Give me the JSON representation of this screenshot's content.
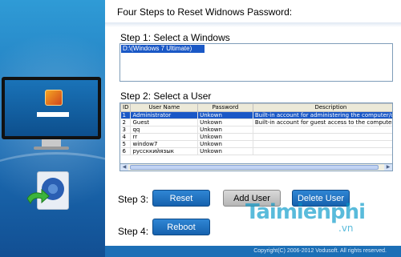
{
  "title": "Four Steps to Reset Widnows Password:",
  "step1": {
    "label": "Step 1: Select a Windows",
    "windows": [
      "D:\\(Windows 7 Ultimate)"
    ]
  },
  "step2": {
    "label": "Step 2: Select a User",
    "columns": [
      "ID",
      "User Name",
      "Password",
      "Description"
    ],
    "rows": [
      {
        "id": "1",
        "name": "Administrator",
        "password": "Unkown",
        "description": "Built-in account for administering the computer/doma"
      },
      {
        "id": "2",
        "name": "Guest",
        "password": "Unkown",
        "description": "Built-in account for guest access to the computer/do"
      },
      {
        "id": "3",
        "name": "qq",
        "password": "Unkown",
        "description": ""
      },
      {
        "id": "4",
        "name": "rr",
        "password": "Unkown",
        "description": ""
      },
      {
        "id": "5",
        "name": "window7",
        "password": "Unkown",
        "description": ""
      },
      {
        "id": "6",
        "name": "руссккийязык",
        "password": "Unkown",
        "description": ""
      }
    ],
    "selected_row": 0
  },
  "step3": {
    "label": "Step 3:",
    "reset_label": "Reset",
    "add_user_label": "Add User",
    "delete_user_label": "Delete User"
  },
  "step4": {
    "label": "Step 4:",
    "reboot_label": "Reboot"
  },
  "footer": "Copyright(C) 2006-2012 Vodusoft. All rights reserved.",
  "watermark": {
    "main": "Taimienphi",
    "suffix": ".vn"
  },
  "colors": {
    "accent_blue": "#1c6fb6",
    "selection": "#1a58c6",
    "button_blue": "#1661ae"
  },
  "icons": [
    "monitor-icon",
    "app-icon"
  ]
}
